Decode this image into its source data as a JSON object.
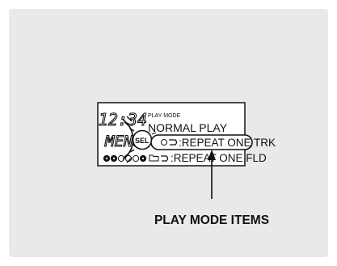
{
  "display": {
    "clock": "12:34",
    "menu_label": "MENU",
    "sel_label": "SEL",
    "mode_header": "PLAY MODE",
    "items": [
      {
        "label": "NORMAL PLAY",
        "icon": ""
      },
      {
        "label": ":REPEAT ONE TRK",
        "icon": "repeat-track-icon",
        "selected": true
      },
      {
        "label": ":REPEAT ONE FLD",
        "icon": "repeat-folder-icon"
      }
    ]
  },
  "callout": {
    "label": "PLAY MODE ITEMS"
  }
}
